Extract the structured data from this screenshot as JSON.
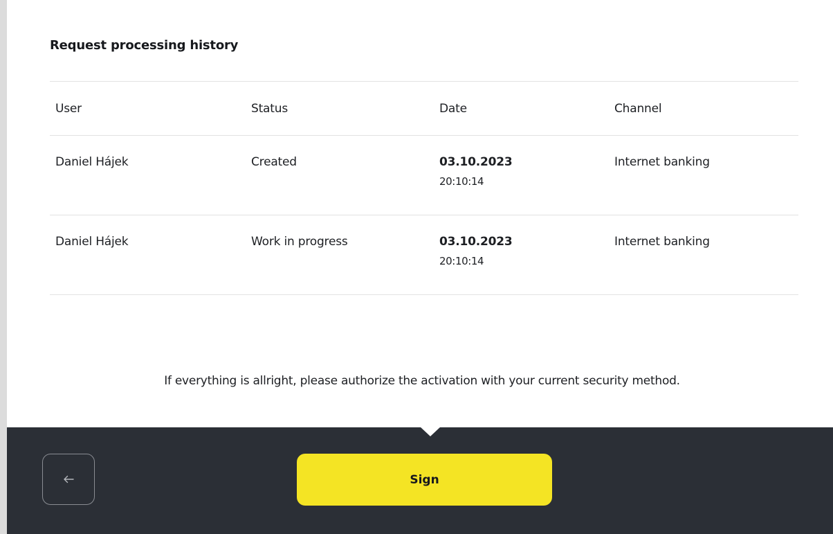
{
  "history": {
    "title": "Request processing history",
    "columns": [
      "User",
      "Status",
      "Date",
      "Channel"
    ],
    "rows": [
      {
        "user": "Daniel Hájek",
        "status": "Created",
        "date": "03.10.2023",
        "time": "20:10:14",
        "channel": "Internet banking"
      },
      {
        "user": "Daniel Hájek",
        "status": "Work in progress",
        "date": "03.10.2023",
        "time": "20:10:14",
        "channel": "Internet banking"
      }
    ]
  },
  "notice": "If everything is allright, please authorize the activation with your current security method.",
  "footer": {
    "back_icon": "arrow-left-icon",
    "sign_label": "Sign"
  },
  "colors": {
    "footer_background": "#2b2f36",
    "sign_button": "#f4e424"
  }
}
